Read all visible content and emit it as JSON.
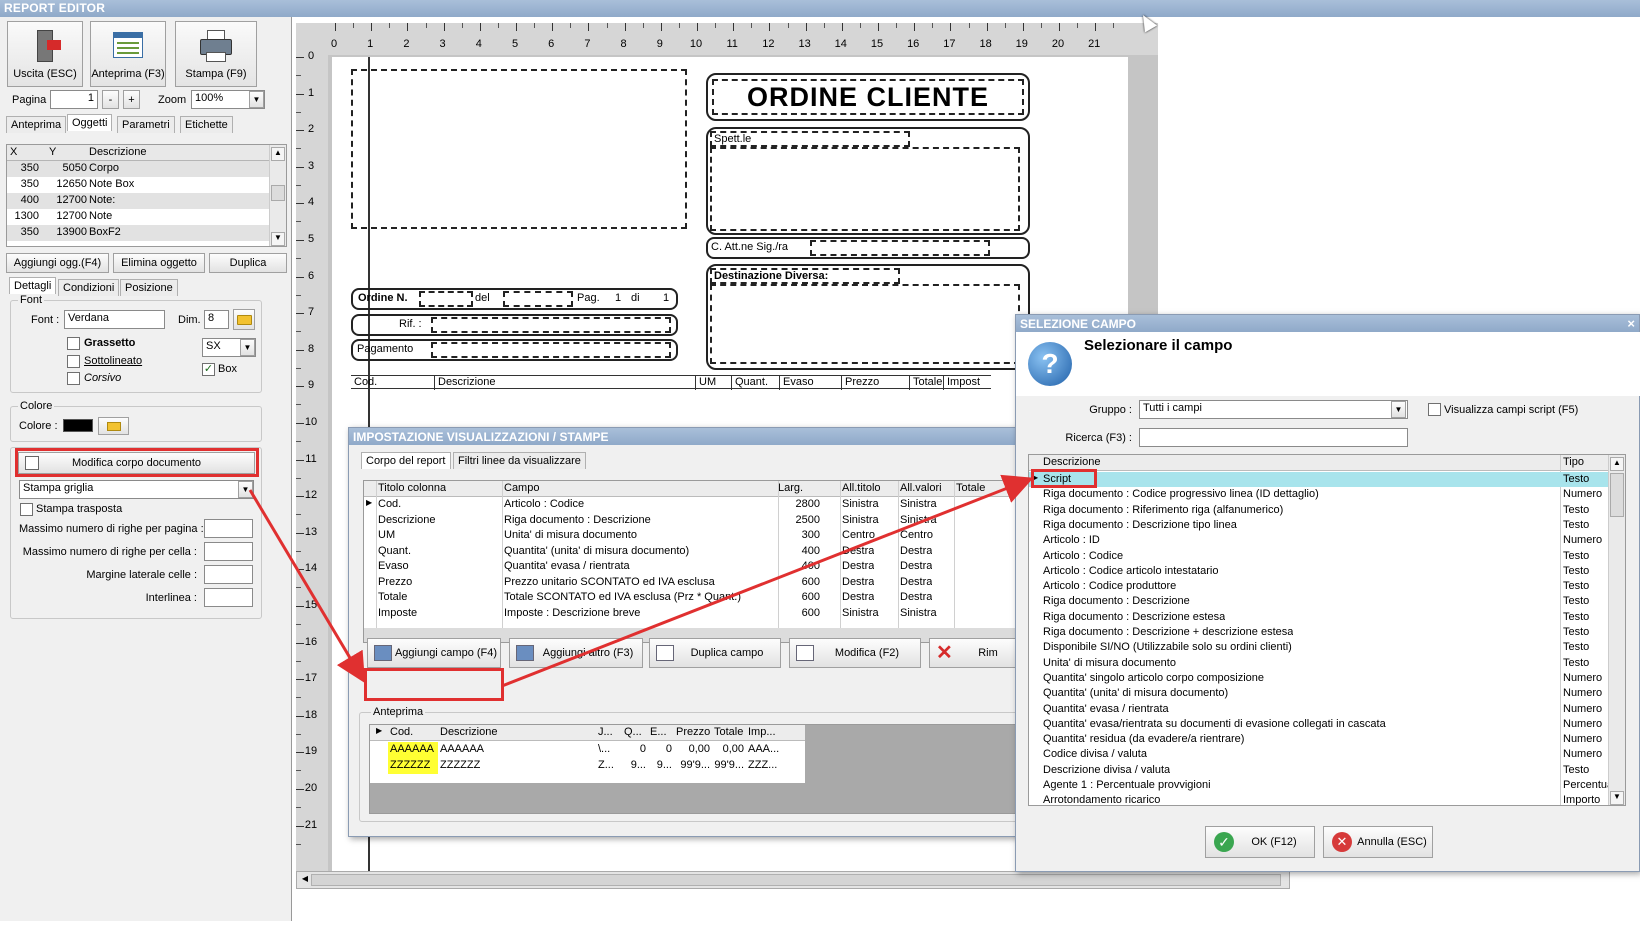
{
  "window_title": "REPORT EDITOR",
  "toolbar": {
    "exit": "Uscita (ESC)",
    "preview": "Anteprima (F3)",
    "print": "Stampa (F9)"
  },
  "pager": {
    "page_label": "Pagina",
    "page_value": "1",
    "minus": "-",
    "plus": "+",
    "zoom_label": "Zoom",
    "zoom_value": "100%"
  },
  "left_tabs": [
    "Anteprima",
    "Oggetti",
    "Parametri",
    "Etichette"
  ],
  "objects": {
    "headers": [
      "X",
      "Y",
      "Descrizione"
    ],
    "rows": [
      [
        "350",
        "5050",
        "Corpo"
      ],
      [
        "350",
        "12650",
        "Note Box"
      ],
      [
        "400",
        "12700",
        "Note:"
      ],
      [
        "1300",
        "12700",
        "Note"
      ],
      [
        "350",
        "13900",
        "BoxF2"
      ]
    ]
  },
  "object_buttons": {
    "add": "Aggiungi ogg.(F4)",
    "delete": "Elimina oggetto",
    "duplicate": "Duplica"
  },
  "detail_tabs": [
    "Dettagli",
    "Condizioni",
    "Posizione"
  ],
  "font": {
    "group": "Font",
    "font_label": "Font :",
    "font_value": "Verdana",
    "dim_label": "Dim.",
    "dim_value": "8",
    "bold": "Grassetto",
    "underline": "Sottolineato",
    "italic": "Corsivo",
    "align_value": "SX",
    "box": "Box"
  },
  "color": {
    "group": "Colore",
    "label": "Colore :",
    "swatch": "#000000"
  },
  "body": {
    "modify": "Modifica corpo documento",
    "grid_select": "Stampa griglia",
    "transposed": "Stampa trasposta",
    "max_rows_page": "Massimo numero di righe per pagina :",
    "max_rows_cell": "Massimo numero di righe per cella :",
    "margin": "Margine laterale celle :",
    "spacing": "Interlinea :"
  },
  "ruler": {
    "h": [
      "0",
      "1",
      "2",
      "3",
      "4",
      "5",
      "6",
      "7",
      "8",
      "9",
      "10",
      "11",
      "12",
      "13",
      "14",
      "15",
      "16",
      "17",
      "18",
      "19",
      "20",
      "21"
    ],
    "v": [
      "0",
      "1",
      "2",
      "3",
      "4",
      "5",
      "6",
      "7",
      "8",
      "9",
      "10",
      "11",
      "12",
      "13",
      "14",
      "15",
      "16",
      "17",
      "18",
      "19",
      "20",
      "21"
    ]
  },
  "report": {
    "title": "ORDINE CLIENTE",
    "spett": "Spett.le",
    "att": "C. Att.ne Sig./ra",
    "dest": "Destinazione Diversa:",
    "order": "Ordine N.",
    "del": "del",
    "pag": "Pag.",
    "pag_n": "1",
    "di": "di",
    "di_n": "1",
    "rif": "Rif. :",
    "pagamento": "Pagamento",
    "cols": [
      "Cod.",
      "Descrizione",
      "UM",
      "Quant.",
      "Evaso",
      "Prezzo",
      "Totale",
      "Impost"
    ]
  },
  "impost": {
    "title": "IMPOSTAZIONE VISUALIZZAZIONI / STAMPE",
    "tabs": [
      "Corpo del report",
      "Filtri linee da visualizzare"
    ],
    "headers": [
      "Titolo colonna",
      "Campo",
      "Larg.",
      "All.titolo",
      "All.valori",
      "Totale"
    ],
    "rows": [
      [
        "Cod.",
        "Articolo : Codice",
        "2800",
        "Sinistra",
        "Sinistra"
      ],
      [
        "Descrizione",
        "Riga documento : Descrizione",
        "2500",
        "Sinistra",
        "Sinistra"
      ],
      [
        "UM",
        "Unita' di misura documento",
        "300",
        "Centro",
        "Centro"
      ],
      [
        "Quant.",
        "Quantita' (unita' di misura documento)",
        "400",
        "Destra",
        "Destra"
      ],
      [
        "Evaso",
        "Quantita' evasa / rientrata",
        "400",
        "Destra",
        "Destra"
      ],
      [
        "Prezzo",
        "Prezzo unitario SCONTATO ed IVA esclusa",
        "600",
        "Destra",
        "Destra"
      ],
      [
        "Totale",
        "Totale SCONTATO ed IVA esclusa (Prz * Quant.)",
        "600",
        "Destra",
        "Destra"
      ],
      [
        "Imposte",
        "Imposte : Descrizione breve",
        "600",
        "Sinistra",
        "Sinistra"
      ]
    ],
    "buttons": [
      "Aggiungi campo (F4)",
      "Aggiungi altro (F3)",
      "Duplica campo",
      "Modifica (F2)",
      "Rim"
    ],
    "preview_label": "Anteprima",
    "preview_headers": [
      "Cod.",
      "Descrizione",
      "J...",
      "Q...",
      "E...",
      "Prezzo",
      "Totale",
      "Imp..."
    ],
    "preview_rows": [
      [
        "AAAAAA",
        "AAAAAA",
        "\\...",
        "0",
        "0",
        "0,00",
        "0,00",
        "AAA..."
      ],
      [
        "ZZZZZZ",
        "ZZZZZZ",
        "Z...",
        "9...",
        "9...",
        "99'9...",
        "99'9...",
        "ZZZ..."
      ]
    ]
  },
  "sel": {
    "title": "SELEZIONE CAMPO",
    "heading": "Selezionare il campo",
    "group_label": "Gruppo :",
    "group_value": "Tutti i campi",
    "script_chk": "Visualizza campi script (F5)",
    "search_label": "Ricerca (F3) :",
    "headers": [
      "Descrizione",
      "Tipo"
    ],
    "rows": [
      [
        "Script",
        "Testo"
      ],
      [
        "Riga documento : Codice progressivo linea (ID dettaglio)",
        "Numero"
      ],
      [
        "Riga documento : Riferimento riga (alfanumerico)",
        "Testo"
      ],
      [
        "Riga documento : Descrizione tipo linea",
        "Testo"
      ],
      [
        "Articolo : ID",
        "Numero"
      ],
      [
        "Articolo : Codice",
        "Testo"
      ],
      [
        "Articolo : Codice articolo intestatario",
        "Testo"
      ],
      [
        "Articolo : Codice produttore",
        "Testo"
      ],
      [
        "Riga documento : Descrizione",
        "Testo"
      ],
      [
        "Riga documento : Descrizione estesa",
        "Testo"
      ],
      [
        "Riga documento : Descrizione + descrizione estesa",
        "Testo"
      ],
      [
        "Disponibile SI/NO (Utilizzabile solo su ordini clienti)",
        "Testo"
      ],
      [
        "Unita' di misura documento",
        "Testo"
      ],
      [
        "Quantita' singolo articolo corpo composizione",
        "Numero"
      ],
      [
        "Quantita' (unita' di misura documento)",
        "Numero"
      ],
      [
        "Quantita' evasa / rientrata",
        "Numero"
      ],
      [
        "Quantita' evasa/rientrata su documenti di evasione collegati in cascata",
        "Numero"
      ],
      [
        "Quantita' residua (da evadere/a rientrare)",
        "Numero"
      ],
      [
        "Codice divisa / valuta",
        "Numero"
      ],
      [
        "Descrizione divisa / valuta",
        "Testo"
      ],
      [
        "Agente 1 : Percentuale provvigioni",
        "Percentuale"
      ],
      [
        "Arrotondamento ricarico",
        "Importo"
      ]
    ],
    "ok": "OK (F12)",
    "cancel": "Annulla (ESC)",
    "close": "×"
  }
}
